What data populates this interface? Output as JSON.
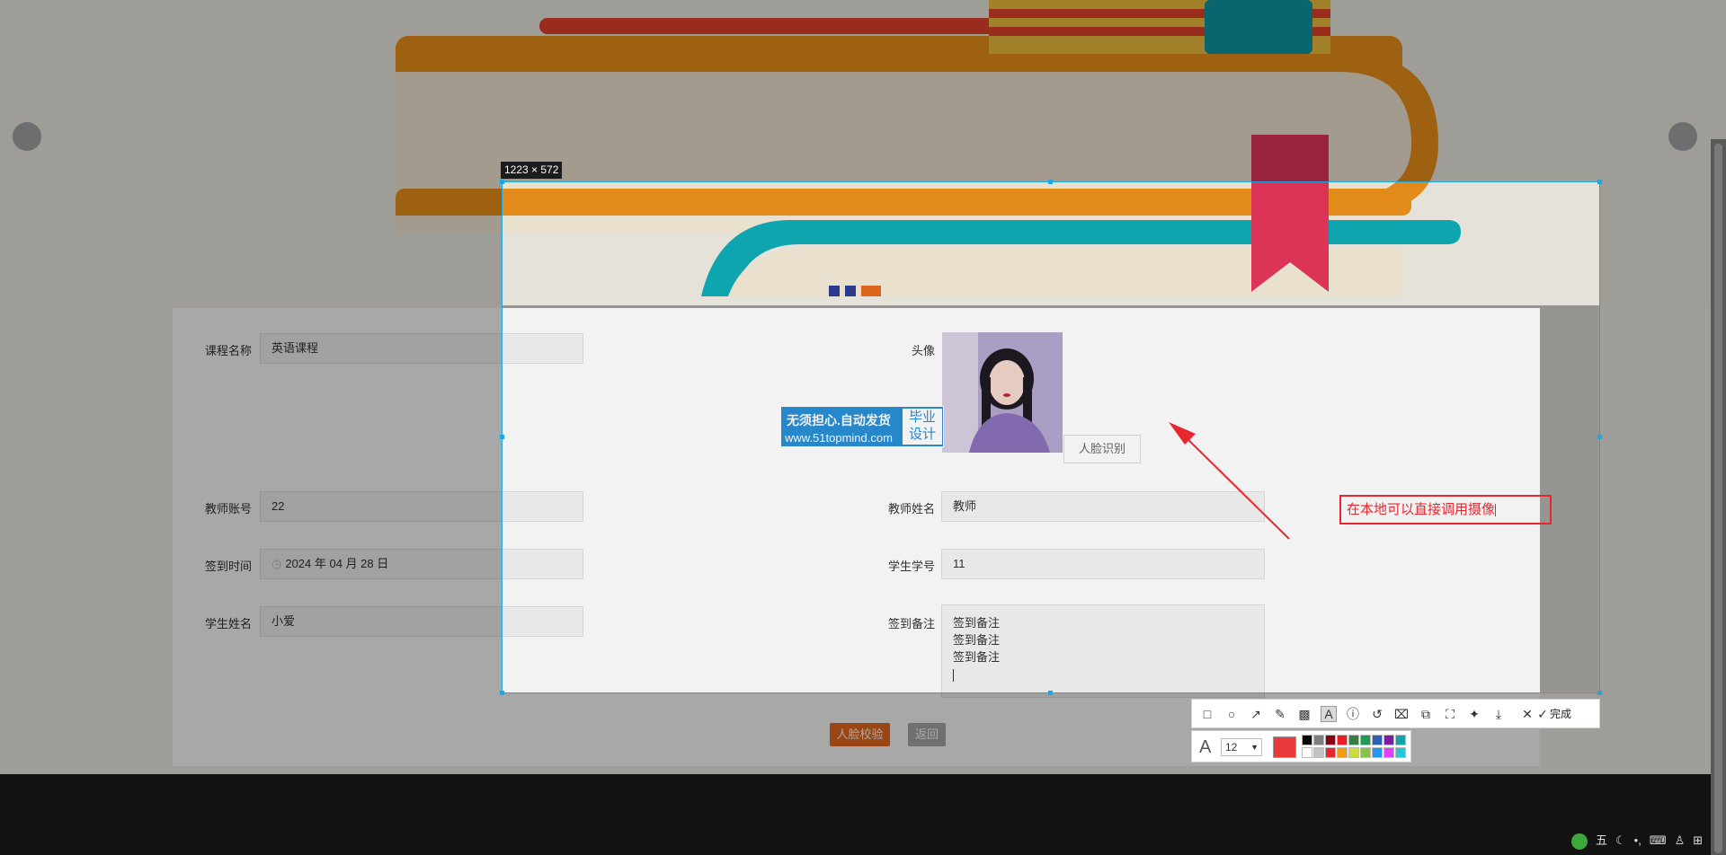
{
  "form": {
    "course_name": {
      "label": "课程名称",
      "value": "英语课程"
    },
    "avatar": {
      "label": "头像"
    },
    "face_recognize_button": "人脸识别",
    "teacher_account": {
      "label": "教师账号",
      "value": "22"
    },
    "teacher_name": {
      "label": "教师姓名",
      "value": "教师"
    },
    "signin_time": {
      "label": "签到时间",
      "value": "2024 年 04 月 28 日"
    },
    "student_id": {
      "label": "学生学号",
      "value": "11"
    },
    "student_name": {
      "label": "学生姓名",
      "value": "小爱"
    },
    "signin_note": {
      "label": "签到备注",
      "lines": [
        "签到备注",
        "签到备注",
        "签到备注"
      ]
    },
    "verify_button": "人脸校验",
    "back_button": "返回"
  },
  "watermark": {
    "line1": "无须担心.自动发货",
    "line2": "www.51topmind.com",
    "right_line1": "毕业",
    "right_line2": "设计"
  },
  "screenshot_tool": {
    "selection_size": "1223 × 572",
    "annotation_text": "在本地可以直接调用摄像",
    "done_label": "完成",
    "font_size": "12",
    "current_color": "#e83a3a",
    "palette_row1": [
      "#000000",
      "#7f7f7f",
      "#880015",
      "#ed1c24",
      "#3a7d44",
      "#1f9a56",
      "#2d5fb5",
      "#7b1fa2",
      "#12a3a8"
    ],
    "palette_row2": [
      "#ffffff",
      "#c3c3c3",
      "#e8262d",
      "#f39c12",
      "#cddc39",
      "#8bc34a",
      "#2196f3",
      "#e040fb",
      "#26c6da"
    ]
  },
  "colors": {
    "accent_orange": "#e86b1f",
    "selection_border": "#1ea7e1",
    "annotation_red": "#e8262d"
  },
  "taskbar": {
    "ime": "五"
  }
}
